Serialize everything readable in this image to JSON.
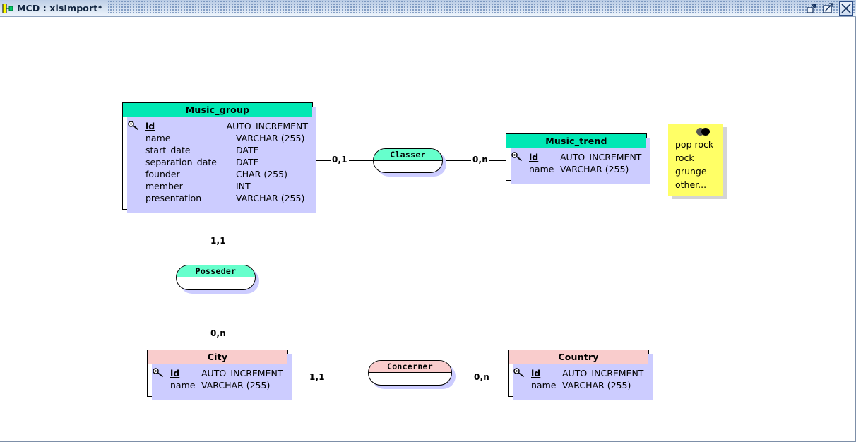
{
  "window": {
    "title": "MCD : xlsImport*",
    "app_icon": "mcd-app-icon",
    "controls": [
      {
        "name": "restore-down-button",
        "glyph": "restore"
      },
      {
        "name": "maximize-button",
        "glyph": "maximize"
      },
      {
        "name": "close-button",
        "glyph": "close"
      }
    ]
  },
  "diagram": {
    "entities": [
      {
        "name": "Music_group",
        "header_color": "#00e8b4",
        "attributes": [
          {
            "key": true,
            "name": "id",
            "type": "AUTO_INCREMENT"
          },
          {
            "key": false,
            "name": "name",
            "type": "VARCHAR (255)"
          },
          {
            "key": false,
            "name": "start_date",
            "type": "DATE"
          },
          {
            "key": false,
            "name": "separation_date",
            "type": "DATE"
          },
          {
            "key": false,
            "name": "founder",
            "type": "CHAR (255)"
          },
          {
            "key": false,
            "name": "member",
            "type": "INT"
          },
          {
            "key": false,
            "name": "presentation",
            "type": "VARCHAR (255)"
          }
        ]
      },
      {
        "name": "Music_trend",
        "header_color": "#00e8b4",
        "attributes": [
          {
            "key": true,
            "name": "id",
            "type": "AUTO_INCREMENT"
          },
          {
            "key": false,
            "name": "name",
            "type": "VARCHAR (255)"
          }
        ]
      },
      {
        "name": "City",
        "header_color": "#f9cccc",
        "attributes": [
          {
            "key": true,
            "name": "id",
            "type": "AUTO_INCREMENT"
          },
          {
            "key": false,
            "name": "name",
            "type": "VARCHAR (255)"
          }
        ]
      },
      {
        "name": "Country",
        "header_color": "#f9cccc",
        "attributes": [
          {
            "key": true,
            "name": "id",
            "type": "AUTO_INCREMENT"
          },
          {
            "key": false,
            "name": "name",
            "type": "VARCHAR (255)"
          }
        ]
      }
    ],
    "relationships": [
      {
        "name": "Classer",
        "color": "#66ffcc"
      },
      {
        "name": "Posseder",
        "color": "#66ffcc"
      },
      {
        "name": "Concerner",
        "color": "#f9cccc"
      }
    ],
    "cardinalities": [
      {
        "id": "classer-left",
        "label": "0,1"
      },
      {
        "id": "classer-right",
        "label": "0,n"
      },
      {
        "id": "posseder-top",
        "label": "1,1"
      },
      {
        "id": "posseder-bottom",
        "label": "0,n"
      },
      {
        "id": "concerner-left",
        "label": "1,1"
      },
      {
        "id": "concerner-right",
        "label": "0,n"
      }
    ],
    "note": {
      "lines": [
        "pop rock",
        "rock",
        "grunge",
        "other..."
      ],
      "color": "#ffff66"
    }
  }
}
